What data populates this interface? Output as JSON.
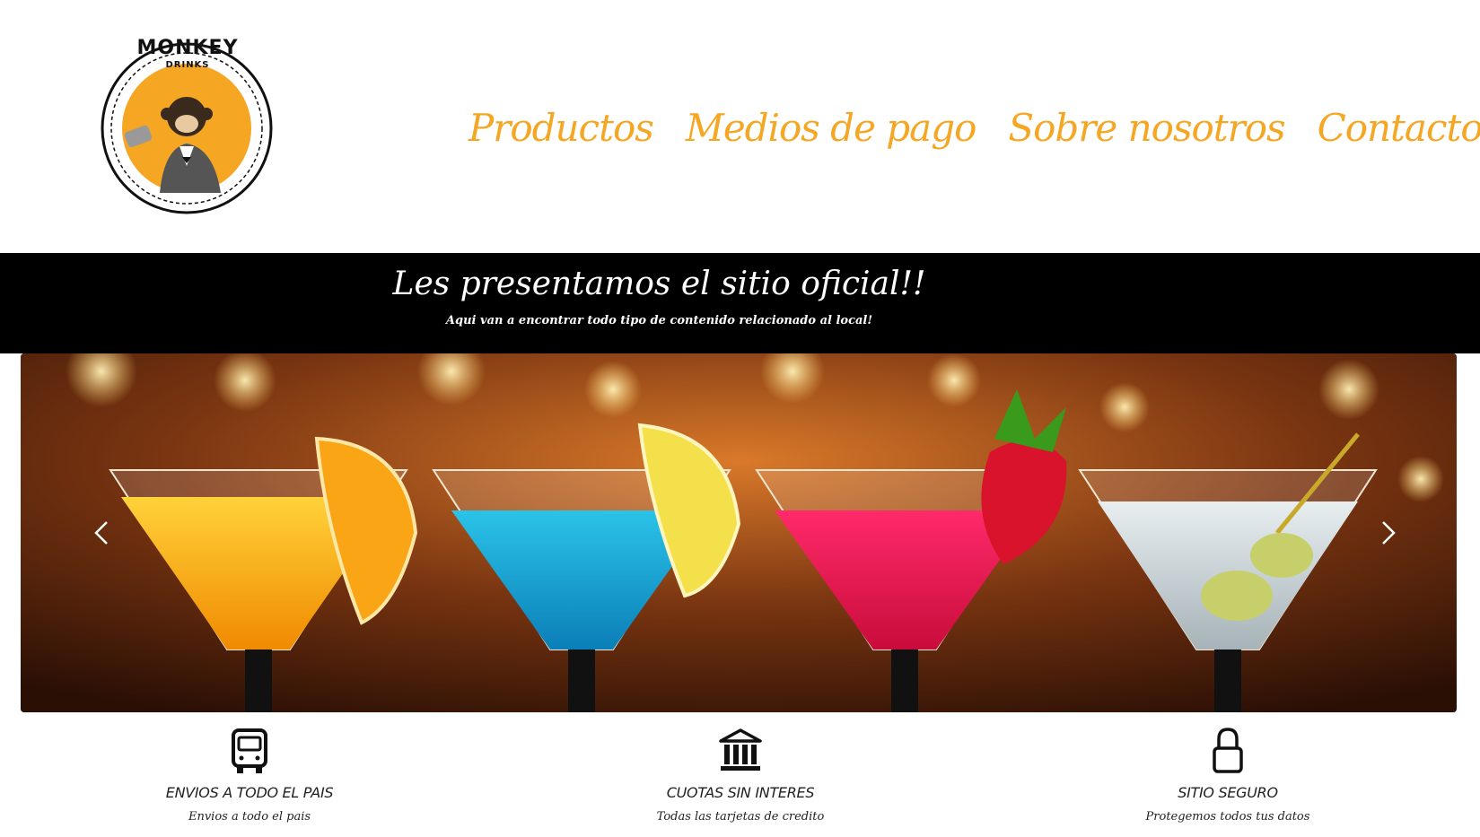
{
  "brand": {
    "name": "MONKEY",
    "tagline": "DRINKS",
    "accent_color": "#f5a623"
  },
  "nav": {
    "items": [
      {
        "label": "Productos"
      },
      {
        "label": "Medios de pago"
      },
      {
        "label": "Sobre nosotros"
      },
      {
        "label": "Contacto"
      }
    ]
  },
  "banner": {
    "title": "Les presentamos el sitio oficial!!",
    "subtitle": "Aqui van a encontrar todo tipo de contenido relacionado al local!"
  },
  "carousel": {
    "prev_icon": "chevron-left-icon",
    "next_icon": "chevron-right-icon"
  },
  "features": [
    {
      "icon": "bus-icon",
      "title": "ENVIOS A TODO EL PAIS",
      "text": "Envios a todo el pais"
    },
    {
      "icon": "bank-icon",
      "title": "CUOTAS SIN INTERES",
      "text": "Todas las tarjetas de credito"
    },
    {
      "icon": "lock-icon",
      "title": "SITIO SEGURO",
      "text": "Protegemos todos tus datos"
    }
  ]
}
